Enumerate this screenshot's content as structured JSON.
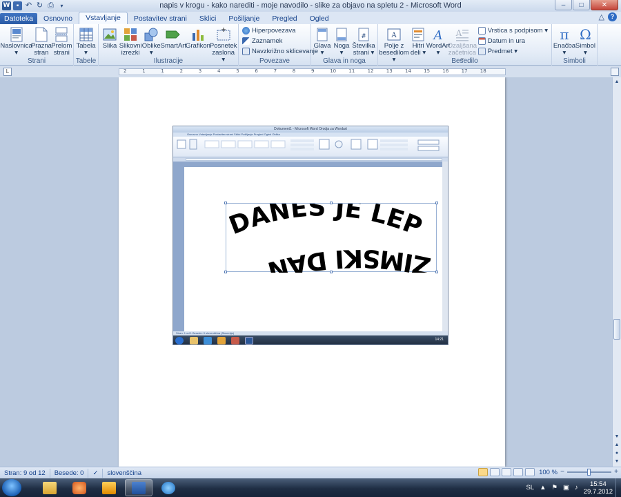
{
  "window": {
    "title": "napis v krogu - kako narediti - moje navodilo - slike za objavo na spletu 2  -  Microsoft Word",
    "logo_letter": "W",
    "minimize": "–",
    "maximize": "□",
    "close": "✕"
  },
  "tabs": [
    {
      "label": "Datoteka"
    },
    {
      "label": "Osnovno"
    },
    {
      "label": "Vstavljanje"
    },
    {
      "label": "Postavitev strani"
    },
    {
      "label": "Sklici"
    },
    {
      "label": "Pošiljanje"
    },
    {
      "label": "Pregled"
    },
    {
      "label": "Ogled"
    }
  ],
  "help": {
    "label": "?",
    "collapse": "△"
  },
  "ribbon": {
    "strani": {
      "label": "Strani",
      "buttons": [
        {
          "label": "Naslovnica\n▾"
        },
        {
          "label": "Prazna\nstran"
        },
        {
          "label": "Prelom\nstrani"
        }
      ]
    },
    "tabele": {
      "label": "Tabele",
      "buttons": [
        {
          "label": "Tabela\n▾"
        }
      ]
    },
    "ilustracije": {
      "label": "Ilustracije",
      "buttons": [
        {
          "label": "Slika"
        },
        {
          "label": "Slikovni\nizrezki"
        },
        {
          "label": "Oblike\n▾"
        },
        {
          "label": "SmartArt"
        },
        {
          "label": "Grafikon"
        },
        {
          "label": "Posnetek\nzaslona ▾"
        }
      ]
    },
    "povezave": {
      "label": "Povezave",
      "buttons": [
        {
          "label": "Hiperpovezava"
        },
        {
          "label": "Zaznamek"
        },
        {
          "label": "Navzkrižno sklicevanje"
        }
      ]
    },
    "glava": {
      "label": "Glava in noga",
      "buttons": [
        {
          "label": "Glava\n▾"
        },
        {
          "label": "Noga\n▾"
        },
        {
          "label": "Številka\nstrani ▾"
        }
      ]
    },
    "besedilo": {
      "label": "Besedilo",
      "buttons": [
        {
          "label": "Polje z\nbesedilom ▾"
        },
        {
          "label": "Hitri\ndeli ▾"
        },
        {
          "label": "WordArt\n▾"
        },
        {
          "label": "Ozaljšana\nzačetnica ▾"
        }
      ],
      "small": [
        {
          "label": "Vrstica s podpisom ▾"
        },
        {
          "label": "Datum in ura"
        },
        {
          "label": "Predmet ▾"
        }
      ]
    },
    "simboli": {
      "label": "Simboli",
      "buttons": [
        {
          "label": "Enačba\n▾",
          "glyph": "π"
        },
        {
          "label": "Simbol\n▾",
          "glyph": "Ω"
        }
      ]
    }
  },
  "ruler": {
    "ticks": [
      "2",
      "1",
      "1",
      "2",
      "3",
      "4",
      "5",
      "6",
      "7",
      "8",
      "9",
      "10",
      "11",
      "12",
      "13",
      "14",
      "15",
      "16",
      "17",
      "18"
    ],
    "toggle": "L"
  },
  "embedded_screenshot": {
    "title": "Dokument1 - Microsoft Word          Orodja za Wordart",
    "tabs": "Osnovno   Vstavljanje   Postavitev strani   Sklici   Pošiljanje   Pregled   Ogled   Oblika",
    "status": "Stran: 1 od 1    Besede: 0    slovenščina (Slovenija)",
    "wordart_top": "DANES JE LEP",
    "wordart_bottom": "ZIMSKI DAN",
    "clock": "14:21"
  },
  "status": {
    "page": "Stran: 9 od 12",
    "words": "Besede: 0",
    "language": "slovenščina",
    "zoom": "100 %",
    "zoom_minus": "−",
    "zoom_plus": "+"
  },
  "taskbar": {
    "language": "SL",
    "time": "15:54",
    "date": "29.7.2012"
  },
  "colors": {
    "accent": "#2b5797",
    "ribbon_bg": "#e4ecf7",
    "doc_bg": "#bccbe0"
  }
}
